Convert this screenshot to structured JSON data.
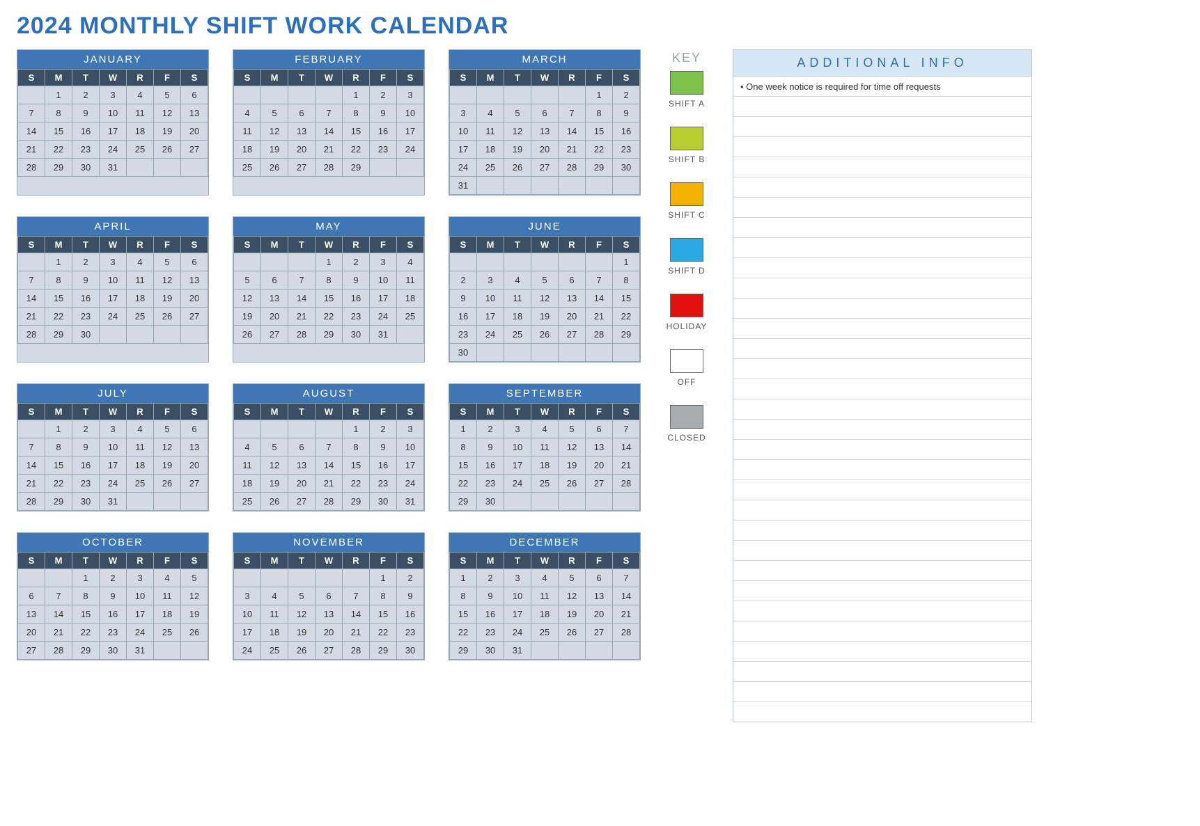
{
  "title": "2024 MONTHLY SHIFT WORK CALENDAR",
  "day_headers": [
    "S",
    "M",
    "T",
    "W",
    "R",
    "F",
    "S"
  ],
  "months": [
    {
      "name": "JANUARY",
      "start": 1,
      "days": 31,
      "rows": 5
    },
    {
      "name": "FEBRUARY",
      "start": 4,
      "days": 29,
      "rows": 5
    },
    {
      "name": "MARCH",
      "start": 5,
      "days": 31,
      "rows": 6
    },
    {
      "name": "APRIL",
      "start": 1,
      "days": 30,
      "rows": 5
    },
    {
      "name": "MAY",
      "start": 3,
      "days": 31,
      "rows": 5
    },
    {
      "name": "JUNE",
      "start": 6,
      "days": 30,
      "rows": 6
    },
    {
      "name": "JULY",
      "start": 1,
      "days": 31,
      "rows": 5
    },
    {
      "name": "AUGUST",
      "start": 4,
      "days": 31,
      "rows": 5
    },
    {
      "name": "SEPTEMBER",
      "start": 0,
      "days": 30,
      "rows": 5
    },
    {
      "name": "OCTOBER",
      "start": 2,
      "days": 31,
      "rows": 5
    },
    {
      "name": "NOVEMBER",
      "start": 5,
      "days": 30,
      "rows": 5
    },
    {
      "name": "DECEMBER",
      "start": 0,
      "days": 31,
      "rows": 5
    }
  ],
  "key": {
    "title": "KEY",
    "items": [
      {
        "label": "SHIFT A",
        "color": "#7cc24a"
      },
      {
        "label": "SHIFT B",
        "color": "#b7cc2f"
      },
      {
        "label": "SHIFT C",
        "color": "#f3b200"
      },
      {
        "label": "SHIFT D",
        "color": "#29a9e1"
      },
      {
        "label": "HOLIDAY",
        "color": "#e41111"
      },
      {
        "label": "OFF",
        "color": "#ffffff"
      },
      {
        "label": "CLOSED",
        "color": "#a9adb0"
      }
    ]
  },
  "info": {
    "header": "ADDITIONAL INFO",
    "rows": [
      "• One week notice is required for time off requests",
      "",
      "",
      "",
      "",
      "",
      "",
      "",
      "",
      "",
      "",
      "",
      "",
      "",
      "",
      "",
      "",
      "",
      "",
      "",
      "",
      "",
      "",
      "",
      "",
      "",
      "",
      "",
      "",
      "",
      "",
      ""
    ]
  }
}
